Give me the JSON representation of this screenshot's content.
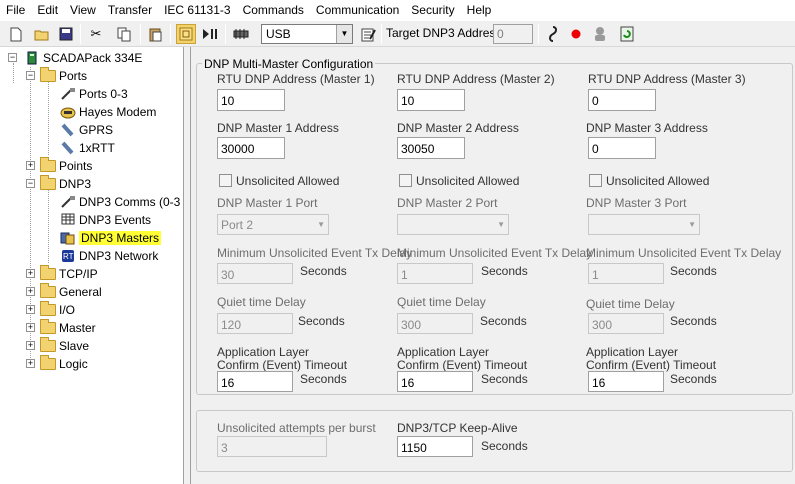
{
  "menu": [
    "File",
    "Edit",
    "View",
    "Transfer",
    "IEC 61131-3",
    "Commands",
    "Communication",
    "Security",
    "Help"
  ],
  "toolbar": {
    "connection_value": "USB",
    "target_label": "Target DNP3 Address",
    "target_value": "0"
  },
  "tree": {
    "root": "SCADAPack 334E",
    "ports": "Ports",
    "ports_0_3": "Ports 0-3",
    "hayes_modem": "Hayes Modem",
    "gprs": "GPRS",
    "onexrtt": "1xRTT",
    "points": "Points",
    "dnp3": "DNP3",
    "dnp3_comms": "DNP3 Comms (0-3",
    "dnp3_events": "DNP3 Events",
    "dnp3_masters": "DNP3 Masters",
    "dnp3_network": "DNP3 Network",
    "tcpip": "TCP/IP",
    "general": "General",
    "io": "I/O",
    "master": "Master",
    "slave": "Slave",
    "logic": "Logic"
  },
  "config": {
    "group_title": "DNP Multi-Master Configuration",
    "seconds": "Seconds",
    "unsolicited_allowed": "Unsolicited Allowed",
    "min_unsol_delay_label": "Minimum Unsolicited Event Tx Delay",
    "quiet_time_label": "Quiet time Delay",
    "app_layer_line1": "Application Layer",
    "app_layer_line2": "Confirm (Event) Timeout",
    "masters": [
      {
        "rtu_label": "RTU DNP Address (Master 1)",
        "rtu_value": "10",
        "addr_label": "DNP Master 1 Address",
        "addr_value": "30000",
        "port_label": "DNP Master 1 Port",
        "port_value": "Port 2",
        "min_delay": "30",
        "quiet": "120",
        "timeout": "16"
      },
      {
        "rtu_label": "RTU DNP Address (Master 2)",
        "rtu_value": "10",
        "addr_label": "DNP Master 2 Address",
        "addr_value": "30050",
        "port_label": "DNP Master 2 Port",
        "port_value": "",
        "min_delay": "1",
        "quiet": "300",
        "timeout": "16"
      },
      {
        "rtu_label": "RTU DNP Address (Master 3)",
        "rtu_value": "0",
        "addr_label": "DNP Master 3 Address",
        "addr_value": "0",
        "port_label": "DNP Master 3 Port",
        "port_value": "",
        "min_delay": "1",
        "quiet": "300",
        "timeout": "16"
      }
    ]
  },
  "bottom": {
    "unsol_attempts_label": "Unsolicited attempts per burst",
    "unsol_attempts_value": "3",
    "keepalive_label": "DNP3/TCP Keep-Alive",
    "keepalive_value": "1150",
    "seconds": "Seconds"
  }
}
